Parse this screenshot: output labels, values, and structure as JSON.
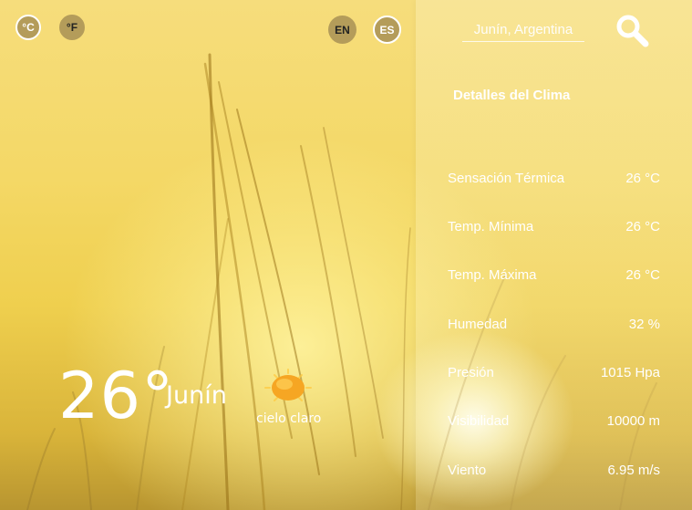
{
  "units": {
    "celsius_label": "°C",
    "fahrenheit_label": "°F"
  },
  "languages": {
    "en_label": "EN",
    "es_label": "ES"
  },
  "current": {
    "temperature": "26°",
    "city": "Junín",
    "condition": "cielo claro",
    "icon": "sun-icon"
  },
  "search": {
    "placeholder": "Junín, Argentina",
    "icon": "search-icon"
  },
  "details": {
    "title": "Detalles del Clima",
    "rows": [
      {
        "label": "Sensación Térmica",
        "value": "26 °C"
      },
      {
        "label": "Temp. Mínima",
        "value": "26 °C"
      },
      {
        "label": "Temp. Máxima",
        "value": "26 °C"
      },
      {
        "label": "Humedad",
        "value": "32 %"
      },
      {
        "label": "Presión",
        "value": "1015 Hpa"
      },
      {
        "label": "Visibilidad",
        "value": "10000 m"
      },
      {
        "label": "Viento",
        "value": "6.95 m/s"
      }
    ]
  },
  "colors": {
    "button_fill": "#b49c5a",
    "text": "#ffffff",
    "background_warm": "#f4d866"
  }
}
